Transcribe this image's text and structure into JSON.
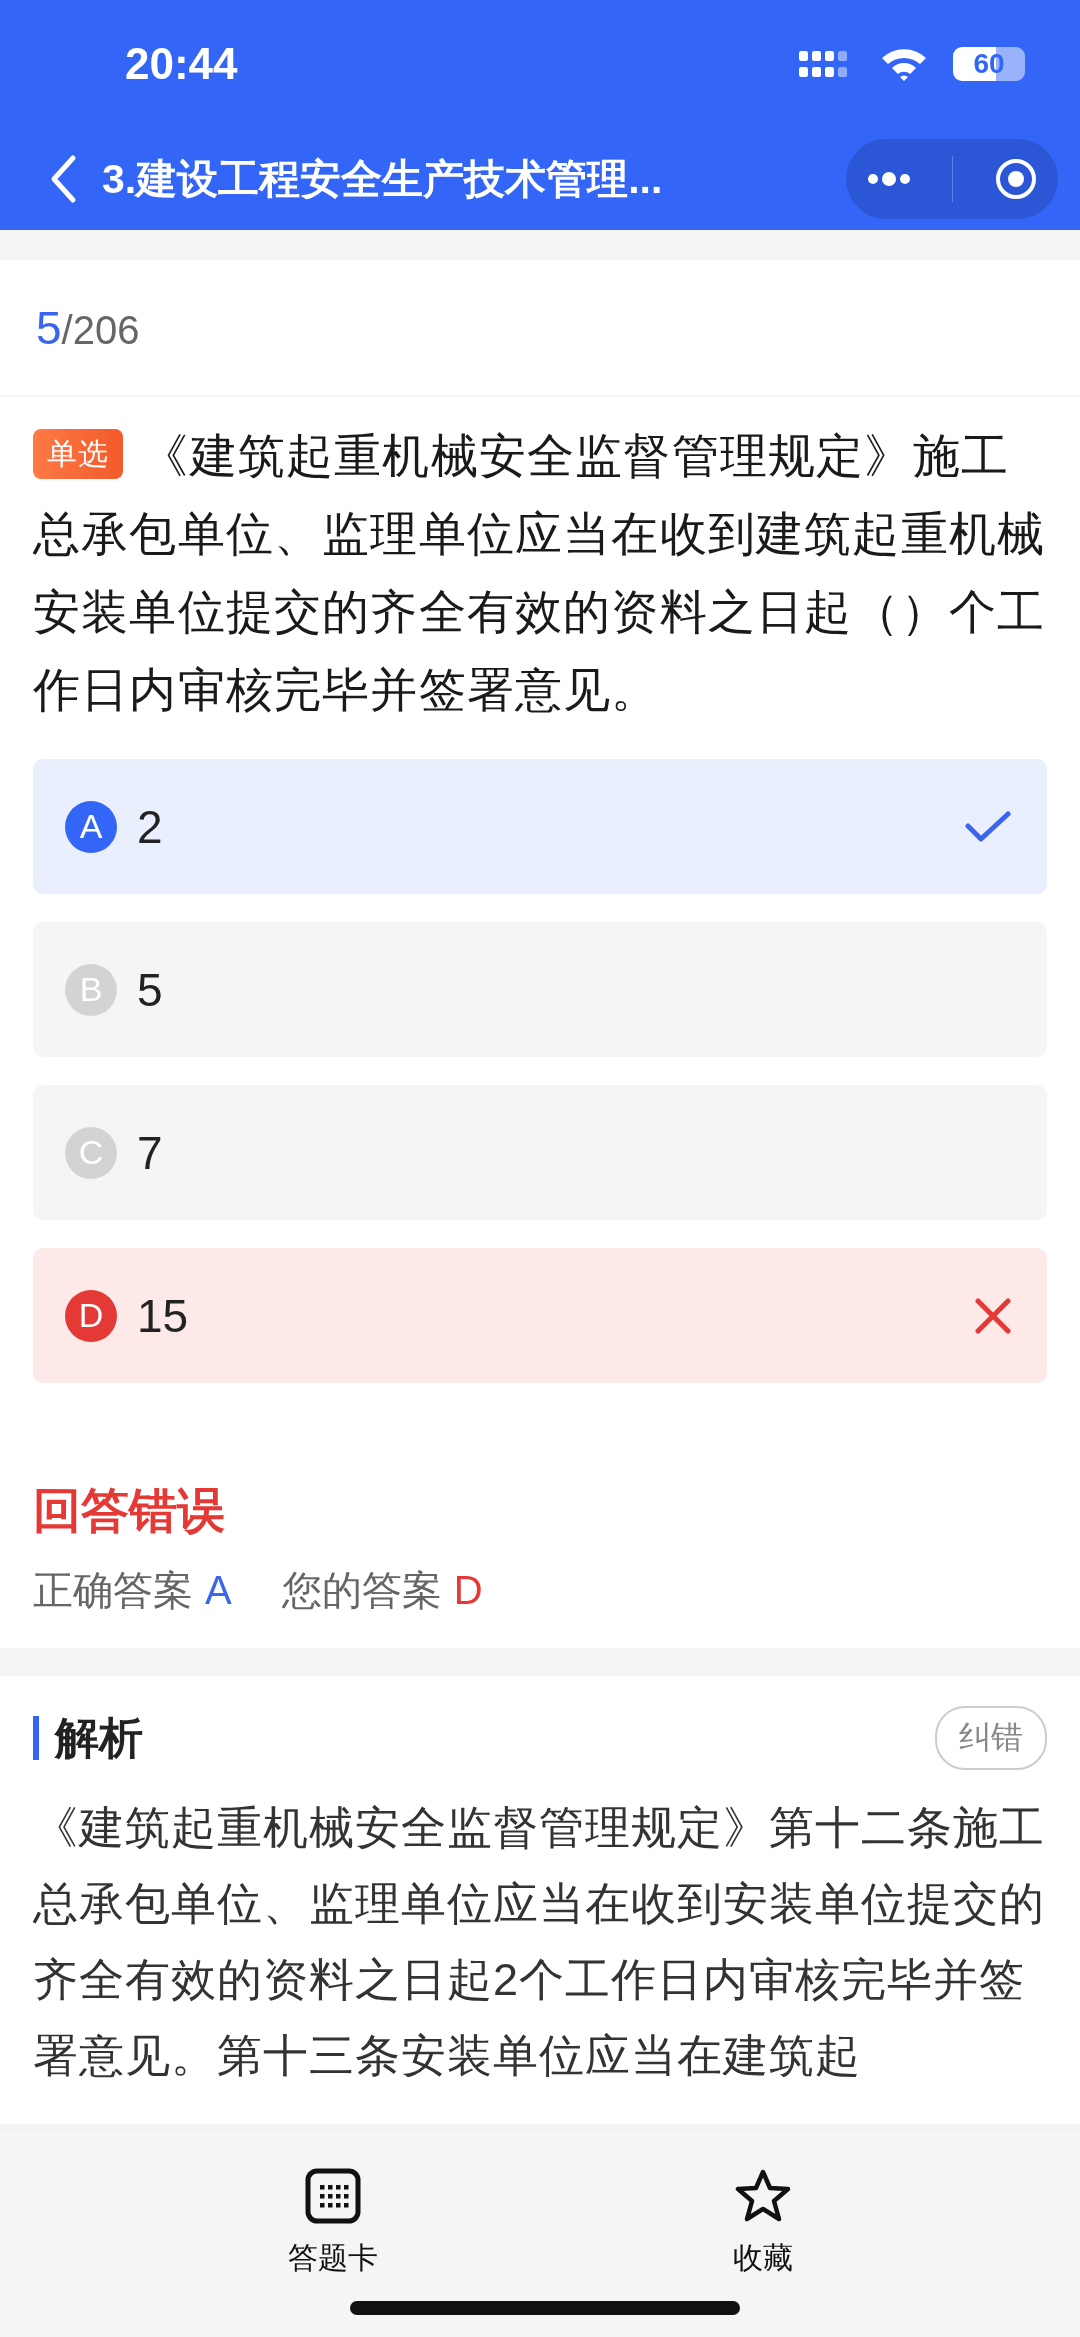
{
  "status_bar": {
    "time": "20:44",
    "battery": "60"
  },
  "nav": {
    "title": "3.建设工程安全生产技术管理..."
  },
  "progress": {
    "current": "5",
    "total": "/206"
  },
  "question": {
    "tag": "单选",
    "text": "《建筑起重机械安全监督管理规定》施工总承包单位、监理单位应当在收到建筑起重机械安装单位提交的齐全有效的资料之日起（）个工作日内审核完毕并签署意见。"
  },
  "options": [
    {
      "letter": "A",
      "text": "2",
      "kind": "correct"
    },
    {
      "letter": "B",
      "text": "5",
      "kind": "plain"
    },
    {
      "letter": "C",
      "text": "7",
      "kind": "plain"
    },
    {
      "letter": "D",
      "text": "15",
      "kind": "wrong"
    }
  ],
  "result": {
    "title": "回答错误",
    "correct_label": "正确答案",
    "correct_value": "A",
    "yours_label": "您的答案",
    "yours_value": "D"
  },
  "analysis": {
    "title": "解析",
    "report_button": "纠错",
    "text": "《建筑起重机械安全监督管理规定》第十二条施工总承包单位、监理单位应当在收到安装单位提交的齐全有效的资料之日起2个工作日内审核完毕并签署意见。第十三条安装单位应当在建筑起"
  },
  "bottom_bar": [
    {
      "label": "答题卡",
      "kind": "grid"
    },
    {
      "label": "收藏",
      "kind": "star"
    }
  ]
}
